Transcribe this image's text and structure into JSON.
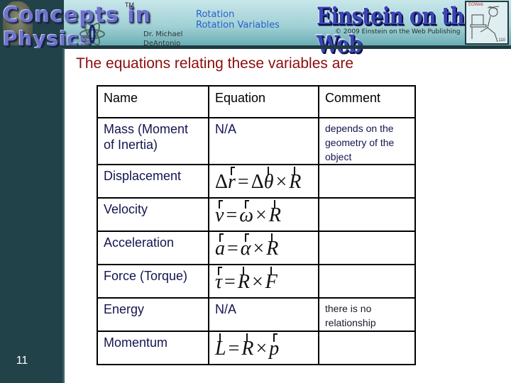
{
  "header": {
    "logo_line1": "Concepts in",
    "logo_line2": "Physics",
    "trademark": "TM",
    "author_line1": "Dr. Michael",
    "author_line2": "DeAntonio",
    "topic_line1": "Rotation",
    "topic_line2": "Rotation Variables",
    "publisher_title": "Einstein on the Web",
    "publisher_copyright": "© 2009 Einstein on the Web Publishing",
    "cartoon_tag": "EOWeb",
    "cartoon_label": "110"
  },
  "slide": {
    "title": "The equations relating these variables are",
    "number": "11"
  },
  "table": {
    "headers": {
      "name": "Name",
      "equation": "Equation",
      "comment": "Comment"
    },
    "rows": [
      {
        "name": "Mass (Moment of Inertia)",
        "equation_text": "N/A",
        "comment": "depends on the geometry of the object"
      },
      {
        "name": "Displacement",
        "equation": [
          "Δ",
          "r",
          "=",
          "Δ",
          "θ",
          "×",
          "R"
        ],
        "comment": ""
      },
      {
        "name": "Velocity",
        "equation": [
          "v",
          "=",
          "ω",
          "×",
          "R"
        ],
        "comment": ""
      },
      {
        "name": "Acceleration",
        "equation": [
          "a",
          "=",
          "α",
          "×",
          "R"
        ],
        "comment": ""
      },
      {
        "name": "Force (Torque)",
        "equation": [
          "τ",
          "=",
          "R",
          "×",
          "F"
        ],
        "comment": ""
      },
      {
        "name": "Energy",
        "equation_text": "N/A",
        "comment": "there is no relationship"
      },
      {
        "name": "Momentum",
        "equation": [
          "L",
          "=",
          "R",
          "×",
          "p"
        ],
        "comment": ""
      }
    ]
  },
  "colors": {
    "sidebar": "#214249",
    "title": "#8b0d0d",
    "table_text": "#131551",
    "topic": "#2a5fd0"
  }
}
